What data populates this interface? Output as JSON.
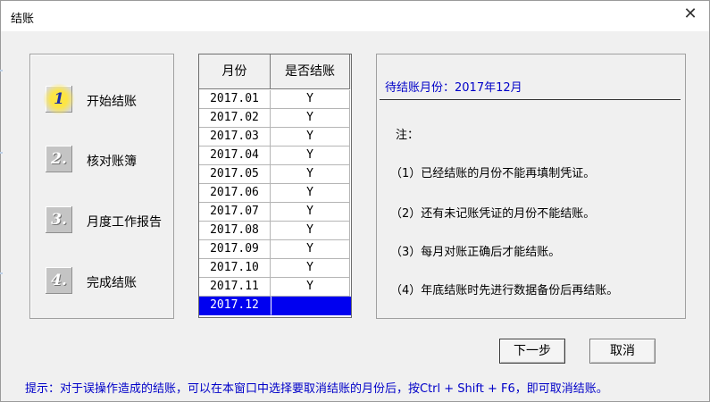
{
  "window": {
    "title": "结账",
    "close_glyph": "✕"
  },
  "steps": [
    {
      "number": "1",
      "label": "开始结账",
      "active": true
    },
    {
      "number": "2.",
      "label": "核对账簿",
      "active": false
    },
    {
      "number": "3.",
      "label": "月度工作报告",
      "active": false
    },
    {
      "number": "4.",
      "label": "完成结账",
      "active": false
    }
  ],
  "grid": {
    "headers": [
      "月份",
      "是否结账"
    ],
    "rows": [
      {
        "month": "2017.01",
        "closed": "Y"
      },
      {
        "month": "2017.02",
        "closed": "Y"
      },
      {
        "month": "2017.03",
        "closed": "Y"
      },
      {
        "month": "2017.04",
        "closed": "Y"
      },
      {
        "month": "2017.05",
        "closed": "Y"
      },
      {
        "month": "2017.06",
        "closed": "Y"
      },
      {
        "month": "2017.07",
        "closed": "Y"
      },
      {
        "month": "2017.08",
        "closed": "Y"
      },
      {
        "month": "2017.09",
        "closed": "Y"
      },
      {
        "month": "2017.10",
        "closed": "Y"
      },
      {
        "month": "2017.11",
        "closed": "Y"
      },
      {
        "month": "2017.12",
        "closed": ""
      }
    ],
    "selected_month": "2017.12"
  },
  "info": {
    "pending_text": "待结账月份：2017年12月",
    "note_title": "注：",
    "notes": [
      "（1）已经结账的月份不能再填制凭证。",
      "（2）还有未记账凭证的月份不能结账。",
      "（3）每月对账正确后才能结账。",
      "（4）年底结账时先进行数据备份后再结账。"
    ]
  },
  "buttons": {
    "next": "下一步",
    "cancel": "取消"
  },
  "hint": "提示：对于误操作造成的结账，可以在本窗口中选择要取消结账的月份后，按Ctrl + Shift + F6，即可取消结账。",
  "colors": {
    "accent_blue": "#0000c8",
    "selection": "#0000f0",
    "window_bg": "#f0f0f0"
  }
}
